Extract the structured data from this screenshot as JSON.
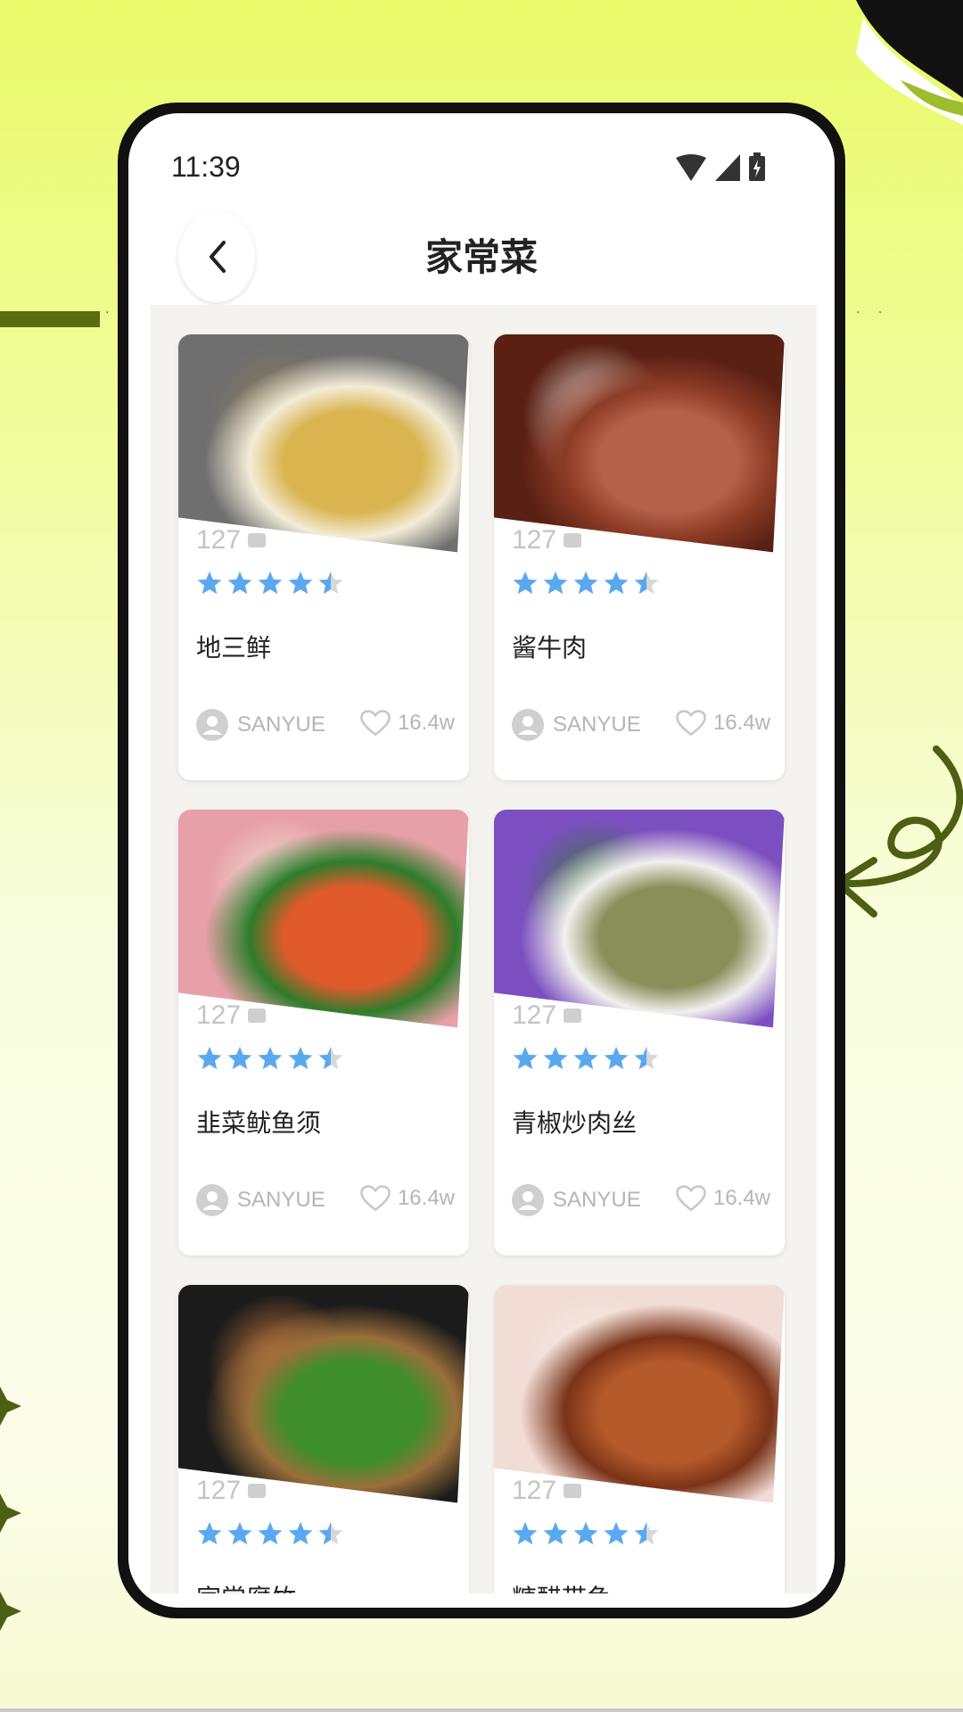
{
  "status": {
    "time": "11:39"
  },
  "header": {
    "title": "家常菜"
  },
  "cards": [
    {
      "name": "地三鲜",
      "comments": "127",
      "rating": 4.5,
      "author": "SANYUE",
      "likes": "16.4w",
      "colors": [
        "#6f6f6f",
        "#f3ecd8",
        "#d9b44f",
        "#8a7a5a"
      ]
    },
    {
      "name": "酱牛肉",
      "comments": "127",
      "rating": 4.5,
      "author": "SANYUE",
      "likes": "16.4w",
      "colors": [
        "#5a2014",
        "#8c3b25",
        "#b4604a",
        "#f0e6de"
      ]
    },
    {
      "name": "韭菜鱿鱼须",
      "comments": "127",
      "rating": 4.5,
      "author": "SANYUE",
      "likes": "16.4w",
      "colors": [
        "#e8a0a8",
        "#2e7d2b",
        "#e05a2b",
        "#f2e8dc"
      ]
    },
    {
      "name": "青椒炒肉丝",
      "comments": "127",
      "rating": 4.5,
      "author": "SANYUE",
      "likes": "16.4w",
      "colors": [
        "#7b4fc0",
        "#f2f0ee",
        "#8a8f5a",
        "#2f7d2b"
      ]
    },
    {
      "name": "家常腐竹",
      "comments": "127",
      "rating": 4.5,
      "author": "",
      "likes": "",
      "colors": [
        "#1b1b1b",
        "#9a6e3a",
        "#3f8f2c",
        "#d88040"
      ]
    },
    {
      "name": "糖醋带鱼",
      "comments": "127",
      "rating": 4.5,
      "author": "",
      "likes": "",
      "colors": [
        "#f2dcd6",
        "#7a3318",
        "#b55a2a",
        "#f5f0e6"
      ]
    }
  ],
  "icons": {
    "back": "chevron-left-icon",
    "wifi": "wifi-icon",
    "signal": "signal-icon",
    "battery": "battery-icon",
    "comment": "comment-bubble-icon",
    "star": "star-icon",
    "avatar": "user-avatar-icon",
    "heart": "heart-icon"
  },
  "theme": {
    "star": "#5aa9f0",
    "accent": "#5a6d12"
  }
}
